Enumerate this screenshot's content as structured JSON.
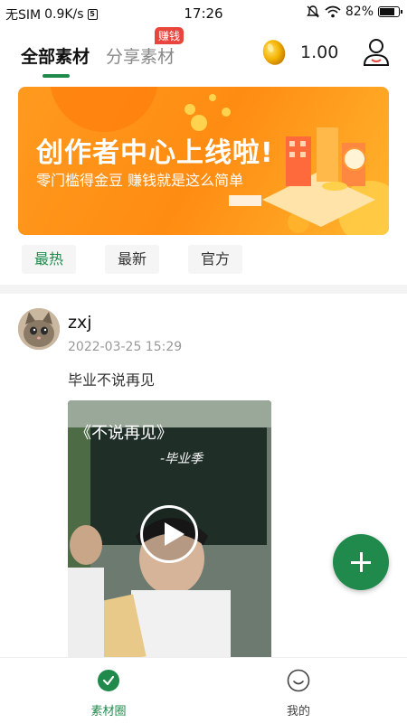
{
  "status_bar": {
    "sim": "无SIM",
    "speed": "0.9K/s",
    "time": "17:26",
    "battery": "82%",
    "battery_level": 0.82
  },
  "top_tabs": {
    "all": "全部素材",
    "share": "分享素材",
    "share_badge": "赚钱"
  },
  "coins": {
    "value": "1.00",
    "icon": "gold-bean-icon"
  },
  "banner": {
    "title": "创作者中心上线啦!",
    "subtitle": "零门槛得金豆 赚钱就是这么简单"
  },
  "filters": [
    "最热",
    "最新",
    "官方"
  ],
  "post": {
    "username": "zxj",
    "time": "2022-03-25 15:29",
    "text": "毕业不说再见",
    "video_title": "《不说再见》",
    "video_subtitle": "-毕业季"
  },
  "bottom_nav": {
    "material": "素材圈",
    "mine": "我的"
  },
  "colors": {
    "accent": "#1f8a4c",
    "badge": "#e8453c",
    "banner": "#ff8c12"
  }
}
